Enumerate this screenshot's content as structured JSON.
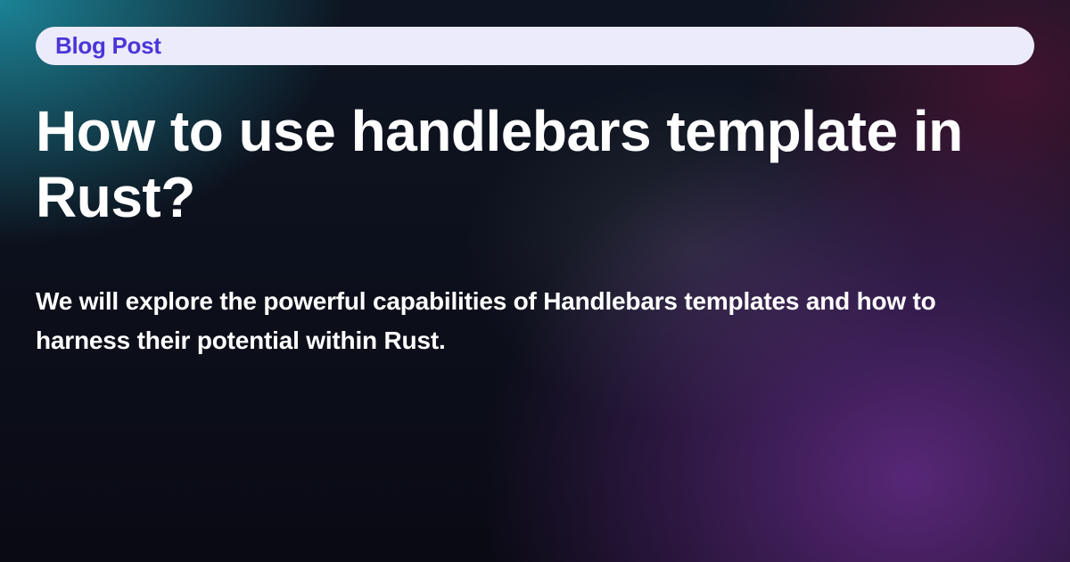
{
  "badge": {
    "label": "Blog Post"
  },
  "title": "How to use handlebars template in Rust?",
  "description": "We will explore the powerful capabilities of Handlebars templates and how to harness their potential within Rust."
}
